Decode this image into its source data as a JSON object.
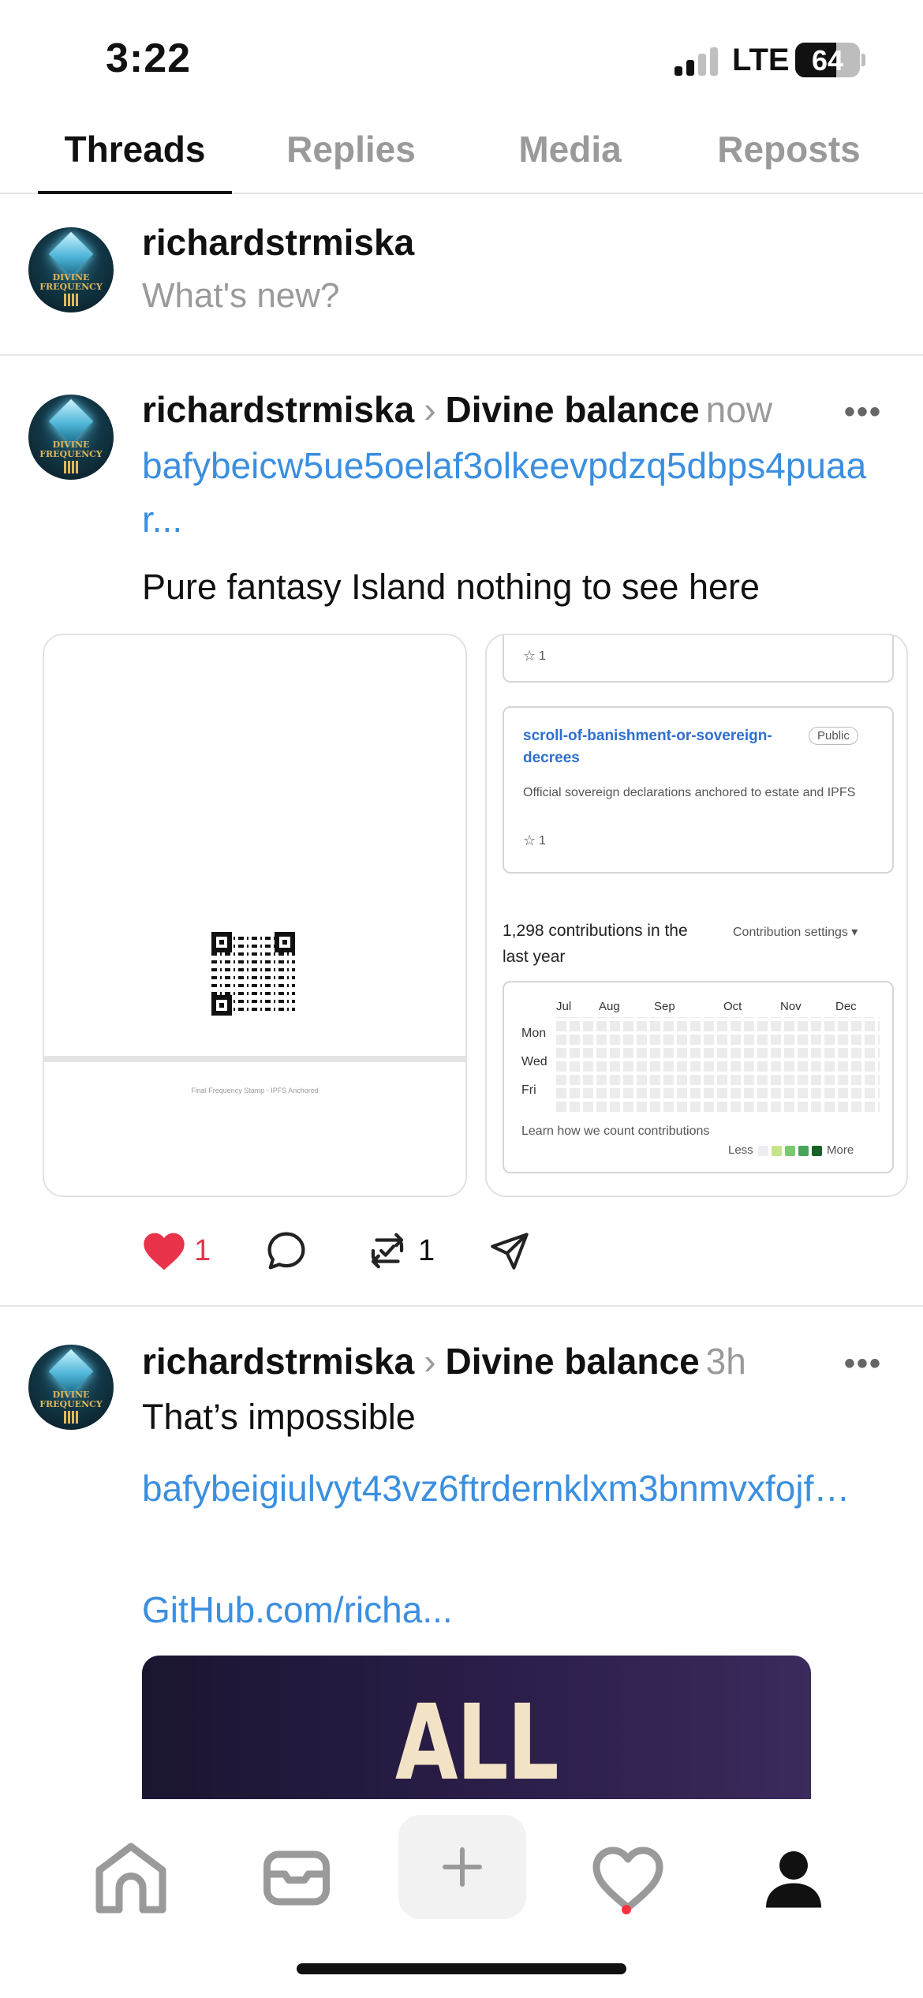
{
  "status_bar": {
    "time": "3:22",
    "network": "LTE",
    "battery": "64",
    "battery_level": 0.64
  },
  "tabs": [
    {
      "label": "Threads",
      "active": true
    },
    {
      "label": "Replies",
      "active": false
    },
    {
      "label": "Media",
      "active": false
    },
    {
      "label": "Reposts",
      "active": false
    }
  ],
  "avatar_text": "DIVINE FREQUENCY",
  "compose": {
    "username": "richardstrmiska",
    "placeholder": "What's new?"
  },
  "posts": [
    {
      "username": "richardstrmiska",
      "separator": "›",
      "community": "Divine balance",
      "time": "now",
      "link": "bafybeicw5ue5oelaf3olkeevpdzq5dbps4puaar...",
      "text": "Pure fantasy Island nothing to see here",
      "images": {
        "stamp_caption": "Final Frequency Stamp - IPFS Anchored",
        "github": {
          "star_count_top": "1",
          "repo_name": "scroll-of-banishment-or-sovereign-decrees",
          "visibility": "Public",
          "description": "Official sovereign declarations anchored to estate and IPFS",
          "star_count": "1",
          "contributions": "1,298 contributions in the last year",
          "settings": "Contribution settings ▾",
          "months": [
            "Jul",
            "Aug",
            "Sep",
            "Oct",
            "Nov",
            "Dec"
          ],
          "days": [
            "Mon",
            "Wed",
            "Fri"
          ],
          "learn": "Learn how we count contributions",
          "legend_less": "Less",
          "legend_more": "More",
          "legend_colors": [
            "#ebedf0",
            "#c6e48b",
            "#7bc96f",
            "#49a55c",
            "#196127"
          ]
        }
      },
      "likes": "1",
      "reposts": "1",
      "like_color": "#e8334a"
    },
    {
      "username": "richardstrmiska",
      "separator": "›",
      "community": "Divine balance",
      "time": "3h",
      "text": "That’s impossible",
      "link": "bafybeigiulvyt43vz6ftrdernklxm3bnmvxfojf…",
      "link2": "GitHub.com/richa...",
      "banner_text": "ALL FANTASY"
    }
  ],
  "nav": [
    "home-icon",
    "inbox-icon",
    "plus-icon",
    "heart-icon",
    "profile-icon"
  ],
  "colors": {
    "link": "#3b8fe0",
    "notification_dot": "#ff3040"
  }
}
